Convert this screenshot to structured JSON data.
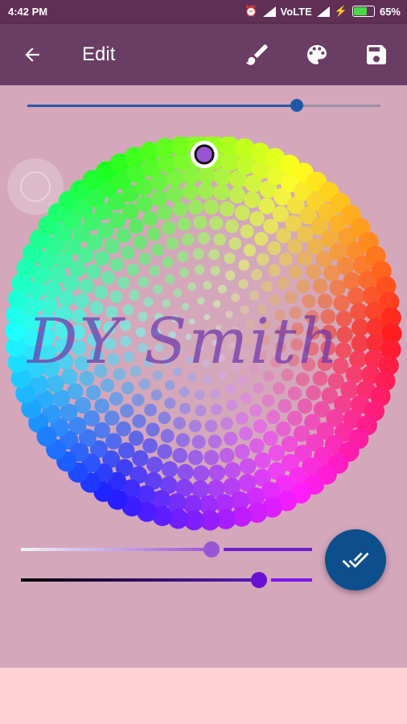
{
  "status": {
    "time": "4:42 PM",
    "network": "VoLTE",
    "battery": "65%"
  },
  "appbar": {
    "title": "Edit",
    "back_icon": "arrow-back-icon",
    "brush_icon": "brush-icon",
    "palette_icon": "palette-icon",
    "save_icon": "save-icon"
  },
  "canvas": {
    "signature_text": "DY Smith"
  },
  "top_slider": {
    "value": 0.76
  },
  "saturation_slider": {
    "value": 0.65
  },
  "brightness_slider": {
    "value": 0.82
  },
  "selected_color": "#9a55d6",
  "fab": {
    "icon": "done-all-icon",
    "color": "#0d4f8c"
  }
}
